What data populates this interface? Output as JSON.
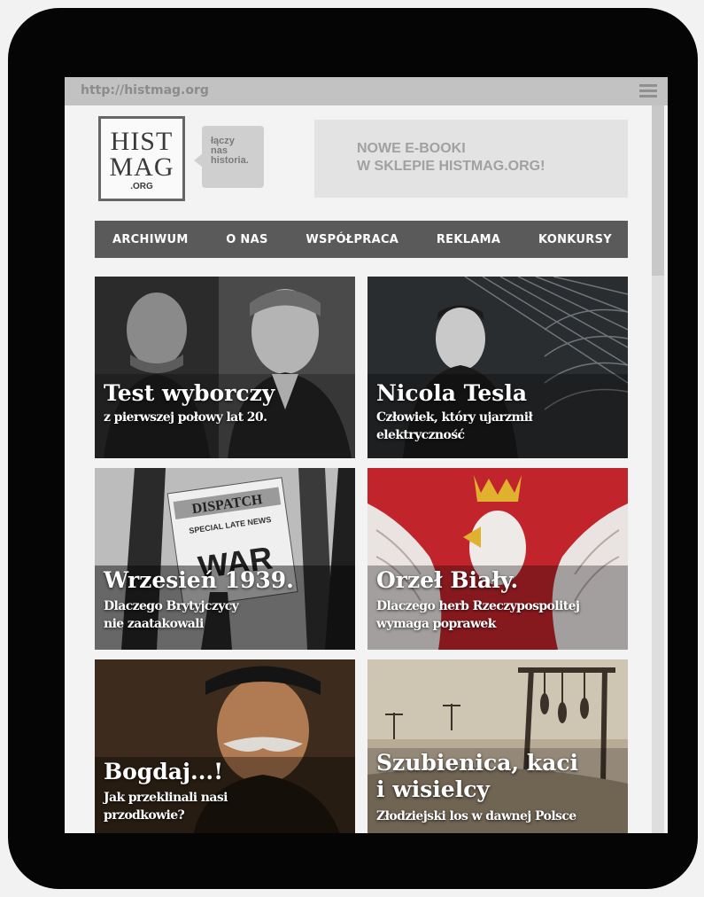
{
  "browser": {
    "url": "http://histmag.org"
  },
  "logo": {
    "line1": "HIST",
    "line2": "MAG",
    "line3": ".ORG"
  },
  "tagline": {
    "line1": "łączy",
    "line2": "nas",
    "line3": "historia."
  },
  "promo": {
    "line1": "NOWE E-BOOKI",
    "line2": "W SKLEPIE HISTMAG.ORG!"
  },
  "nav": {
    "items": [
      "ARCHIWUM",
      "O NAS",
      "WSPÓŁPRACA",
      "REKLAMA",
      "KONKURSY"
    ]
  },
  "tiles": [
    {
      "title": "Test wyborczy",
      "sub1": "z pierwszej połowy lat 20.",
      "sub2": ""
    },
    {
      "title": "Nicola Tesla",
      "sub1": "Człowiek, który ujarzmił",
      "sub2": "elektryczność"
    },
    {
      "title": "Wrzesień 1939.",
      "sub1": "Dlaczego Brytyjczycy",
      "sub2": "nie zaatakowali"
    },
    {
      "title": "Orzeł Biały.",
      "sub1": "Dlaczego herb Rzeczypospolitej",
      "sub2": "wymaga poprawek"
    },
    {
      "title": "Bogdaj...!",
      "sub1": "Jak przeklinali nasi",
      "sub2": "przodkowie?"
    },
    {
      "title": "Szubienica, kaci",
      "title2": "i wisielcy",
      "sub1": "Złodziejski los w dawnej Polsce",
      "sub2": ""
    }
  ],
  "newspaper": {
    "brand": "DISPATCH",
    "edition": "SPECIAL LATE NEWS",
    "headline": "WAR"
  },
  "colors": {
    "nav_bg": "#5a5a5a",
    "urlbar_bg": "#c2c2c2",
    "flag_red": "#c1242b",
    "tablet": "#050505"
  }
}
